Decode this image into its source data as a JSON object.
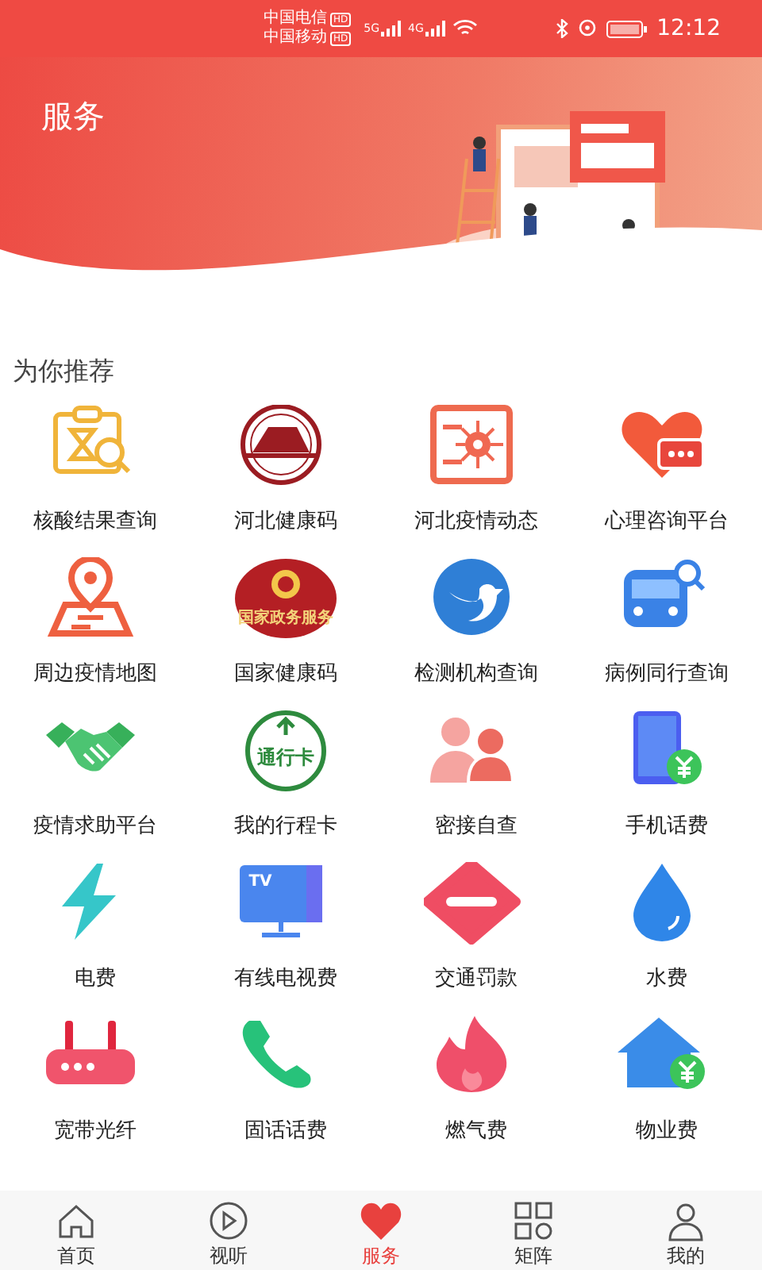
{
  "status_bar": {
    "carriers": [
      {
        "name": "中国电信",
        "badge": "HD"
      },
      {
        "name": "中国移动",
        "badge": "HD"
      }
    ],
    "networks": [
      "5G",
      "4G"
    ],
    "time": "12:12"
  },
  "header": {
    "title": "服务"
  },
  "section": {
    "title": "为你推荐"
  },
  "services": [
    {
      "label": "核酸结果查询",
      "kind": "test-search"
    },
    {
      "label": "河北健康码",
      "kind": "seal"
    },
    {
      "label": "河北疫情动态",
      "kind": "virus-board"
    },
    {
      "label": "心理咨询平台",
      "kind": "heart-chat"
    },
    {
      "label": "周边疫情地图",
      "kind": "map-pin"
    },
    {
      "label": "国家健康码",
      "kind": "emblem",
      "icon_text": "国家政务服务"
    },
    {
      "label": "检测机构查询",
      "kind": "bird"
    },
    {
      "label": "病例同行查询",
      "kind": "bus-search"
    },
    {
      "label": "疫情求助平台",
      "kind": "handshake"
    },
    {
      "label": "我的行程卡",
      "kind": "pass-card",
      "icon_text": "通行卡"
    },
    {
      "label": "密接自查",
      "kind": "people"
    },
    {
      "label": "手机话费",
      "kind": "phone-yen"
    },
    {
      "label": "电费",
      "kind": "bolt"
    },
    {
      "label": "有线电视费",
      "kind": "tv",
      "icon_text": "TV"
    },
    {
      "label": "交通罚款",
      "kind": "no-entry"
    },
    {
      "label": "水费",
      "kind": "drop"
    },
    {
      "label": "宽带光纤",
      "kind": "router"
    },
    {
      "label": "固话话费",
      "kind": "handset"
    },
    {
      "label": "燃气费",
      "kind": "flame"
    },
    {
      "label": "物业费",
      "kind": "house-yen"
    }
  ],
  "tab_bar": [
    {
      "label": "首页",
      "kind": "home",
      "selected": false
    },
    {
      "label": "视听",
      "kind": "play",
      "selected": false
    },
    {
      "label": "服务",
      "kind": "heart",
      "selected": true
    },
    {
      "label": "矩阵",
      "kind": "grid",
      "selected": false
    },
    {
      "label": "我的",
      "kind": "user",
      "selected": false
    }
  ]
}
